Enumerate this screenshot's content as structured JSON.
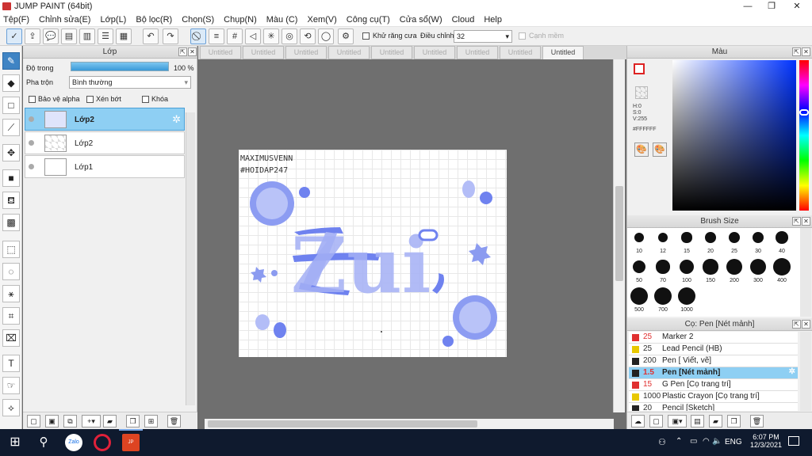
{
  "window": {
    "title": "JUMP PAINT (64bit)",
    "min": "—",
    "max": "❐",
    "close": "✕"
  },
  "menu": [
    "Tệp(F)",
    "Chỉnh sửa(E)",
    "Lớp(L)",
    "Bộ lọc(R)",
    "Chọn(S)",
    "Chụp(N)",
    "Màu (C)",
    "Xem(V)",
    "Công cụ(T)",
    "Cửa sổ(W)",
    "Cloud",
    "Help"
  ],
  "toolbar": {
    "antialias_label": "Khử răng cưa",
    "adjust_label": "Điều chỉnh",
    "adjust_value": "32",
    "smooth_label": "Cạnh mềm"
  },
  "layer_panel": {
    "title": "Lớp",
    "opacity_label": "Độ trong",
    "opacity_value": "100 %",
    "opacity_fraction": 1.0,
    "blend_label": "Pha trộn",
    "blend_value": "Bình thường",
    "protect_alpha": "Bảo vệ alpha",
    "clip": "Xén bớt",
    "lock": "Khóa",
    "layers": [
      {
        "name": "Lớp2",
        "selected": true
      },
      {
        "name": "Lớp2",
        "selected": false
      },
      {
        "name": "Lớp1",
        "selected": false
      }
    ]
  },
  "tabs": [
    "Untitled",
    "Untitled",
    "Untitled",
    "Untitled",
    "Untitled",
    "Untitled",
    "Untitled",
    "Untitled",
    "Untitled"
  ],
  "artwork": {
    "watermark_line1": "MAXIMUSVENN",
    "watermark_line2": "#HOIDAP247",
    "main_text": "Zui"
  },
  "color_panel": {
    "title": "Màu",
    "h": "H:0",
    "s": "S:0",
    "v": "V:255",
    "hex": "#FFFFFF"
  },
  "brush_size_panel": {
    "title": "Brush Size",
    "sizes": [
      "10",
      "12",
      "15",
      "20",
      "25",
      "30",
      "40",
      "50",
      "70",
      "100",
      "150",
      "200",
      "300",
      "400",
      "500",
      "700",
      "1000"
    ]
  },
  "brush_list_panel": {
    "title": "Cọ: Pen [Nét mảnh]",
    "brushes": [
      {
        "size": "25",
        "name": "Marker 2",
        "color": "#e03030"
      },
      {
        "size": "25",
        "name": "Lead Pencil (HB)",
        "color": "#e8c800"
      },
      {
        "size": "200",
        "name": "Pen [ Viết, vẽ]",
        "color": "#222222"
      },
      {
        "size": "1.5",
        "name": "Pen [Nét mảnh]",
        "color": "#222222",
        "selected": true
      },
      {
        "size": "15",
        "name": "G Pen [Cọ trang trí]",
        "color": "#e03030"
      },
      {
        "size": "1000",
        "name": "Plastic Crayon [Cọ trang trí]",
        "color": "#e8c800"
      },
      {
        "size": "20",
        "name": "Pencil [Sketch]",
        "color": "#222222"
      }
    ]
  },
  "taskbar": {
    "lang": "ENG",
    "time": "6:07 PM",
    "date": "12/3/2021"
  },
  "colors": {
    "accent": "#3f84c4",
    "selected_row": "#8ecff3",
    "art_blue": "#7b8df0"
  }
}
